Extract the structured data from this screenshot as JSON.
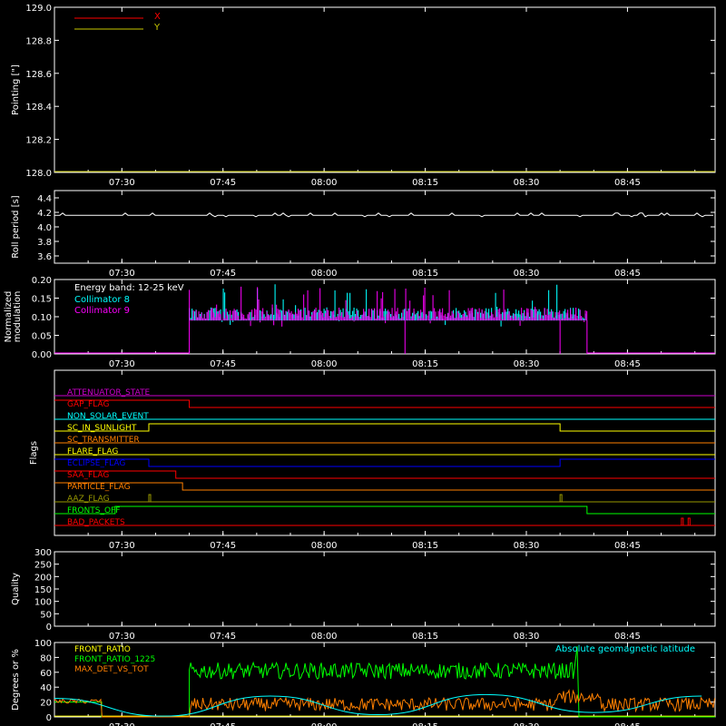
{
  "chart_data": [
    {
      "type": "line",
      "ylabel": "Pointing [\"]",
      "ylim": [
        128.0,
        129.0
      ],
      "yticks": [
        "128.0",
        "128.2",
        "128.4",
        "128.6",
        "128.8",
        "129.0"
      ],
      "xticks": [
        "07:30",
        "07:45",
        "08:00",
        "08:15",
        "08:30",
        "08:45"
      ],
      "legend": "top-left",
      "series": [
        {
          "name": "X",
          "color": "#ff0000",
          "values": []
        },
        {
          "name": "Y",
          "color": "#c8c800",
          "values": []
        }
      ]
    },
    {
      "type": "line",
      "ylabel": "Roll period [s]",
      "ylim": [
        3.5,
        4.5
      ],
      "yticks": [
        "3.6",
        "3.8",
        "4.0",
        "4.2",
        "4.4"
      ],
      "xticks": [
        "07:30",
        "07:45",
        "08:00",
        "08:15",
        "08:30",
        "08:45"
      ],
      "series": [
        {
          "name": "",
          "color": "#ffffff",
          "baseline": 4.16
        }
      ]
    },
    {
      "type": "bar",
      "ylabel_lines": [
        "Normalized",
        "modulation"
      ],
      "ylim": [
        0.0,
        0.2
      ],
      "yticks": [
        "0.00",
        "0.05",
        "0.10",
        "0.15",
        "0.20"
      ],
      "xticks": [
        "07:30",
        "07:45",
        "08:00",
        "08:15",
        "08:30",
        "08:45"
      ],
      "legend_title": "Energy band: 12-25 keV",
      "legend": "top-left",
      "active_window": [
        "07:40",
        "08:39"
      ],
      "series": [
        {
          "name": "Collimator 8",
          "color": "#00ffff"
        },
        {
          "name": "Collimator 9",
          "color": "#ff00ff"
        }
      ]
    },
    {
      "type": "line",
      "ylabel": "Flags",
      "xticks": [
        "07:30",
        "07:45",
        "08:00",
        "08:15",
        "08:30",
        "08:45"
      ],
      "flags": [
        {
          "name": "ATTENUATOR_STATE",
          "color": "#cc00cc",
          "steps": []
        },
        {
          "name": "GAP_FLAG",
          "color": "#ff0000",
          "steps": [
            [
              "07:40",
              -1
            ]
          ]
        },
        {
          "name": "NON_SOLAR_EVENT",
          "color": "#00ffff",
          "steps": []
        },
        {
          "name": "SC_IN_SUNLIGHT",
          "color": "#ffff00",
          "steps": [
            [
              "07:34",
              1
            ],
            [
              "08:35",
              -1
            ]
          ]
        },
        {
          "name": "SC_TRANSMITTER",
          "color": "#ff8000",
          "steps": []
        },
        {
          "name": "FLARE_FLAG",
          "color": "#ffff00",
          "steps": []
        },
        {
          "name": "ECLIPSE_FLAG",
          "color": "#0000ff",
          "steps": [
            [
              "07:34",
              -1
            ],
            [
              "08:35",
              1
            ]
          ]
        },
        {
          "name": "SAA_FLAG",
          "color": "#ff0000",
          "steps": [
            [
              "07:38",
              -1
            ]
          ]
        },
        {
          "name": "PARTICLE_FLAG",
          "color": "#ff8000",
          "steps": [
            [
              "07:39",
              -1
            ]
          ]
        },
        {
          "name": "AAZ_FLAG",
          "color": "#999900",
          "pulses": [
            "07:34",
            "08:35"
          ]
        },
        {
          "name": "FRONTS_OFF",
          "color": "#00ff00",
          "steps": [
            [
              "07:29",
              1
            ],
            [
              "08:39",
              -1
            ]
          ]
        },
        {
          "name": "BAD_PACKETS",
          "color": "#ff0000",
          "pulses": [
            "08:53",
            "08:54"
          ]
        }
      ]
    },
    {
      "type": "line",
      "ylabel": "Quality",
      "ylim": [
        0,
        300
      ],
      "yticks": [
        "0",
        "50",
        "100",
        "150",
        "200",
        "250",
        "300"
      ],
      "xticks": [
        "07:30",
        "07:45",
        "08:00",
        "08:15",
        "08:30",
        "08:45"
      ],
      "series": []
    },
    {
      "type": "line",
      "ylabel": "Degrees or %",
      "ylim": [
        0,
        100
      ],
      "yticks": [
        "0",
        "20",
        "40",
        "60",
        "80",
        "100"
      ],
      "xticks": [
        "07:30",
        "07:45",
        "08:00",
        "08:15",
        "08:30",
        "08:45"
      ],
      "legend": "top-left",
      "annotation": "Absolute geomagnetic latitude",
      "series": [
        {
          "name": "FRONT_RATIO",
          "color": "#ffff00"
        },
        {
          "name": "FRONT_RATIO_1225",
          "color": "#00ff00",
          "approx_level": 62,
          "window": [
            "07:40",
            "08:37"
          ]
        },
        {
          "name": "MAX_DET_VS_TOT",
          "color": "#ff8000",
          "approx_level": 15
        },
        {
          "name": "Absolute geomagnetic latitude",
          "color": "#00ffff",
          "x": [
            "07:20",
            "07:36",
            "07:52",
            "08:08",
            "08:24",
            "08:40",
            "08:56"
          ],
          "values": [
            25,
            1,
            28,
            3,
            30,
            6,
            28
          ]
        }
      ]
    }
  ]
}
